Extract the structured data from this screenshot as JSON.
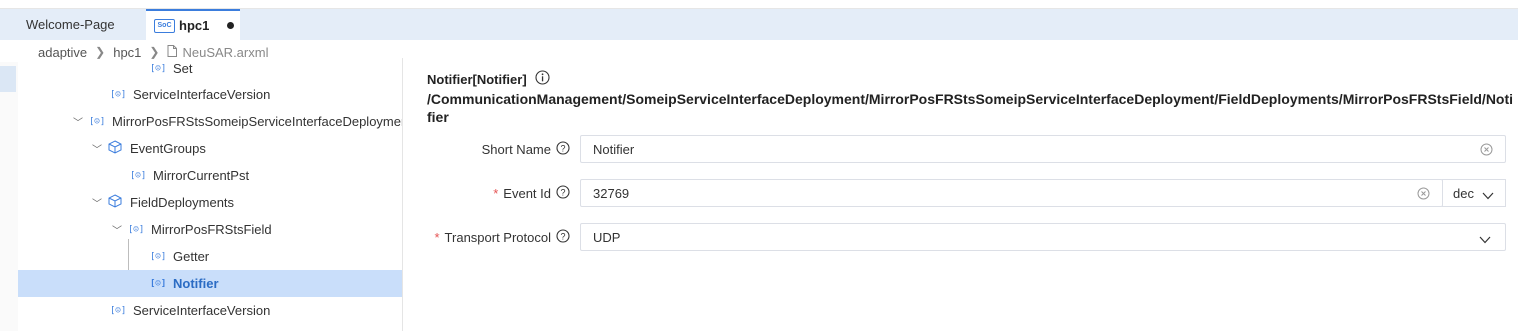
{
  "tabs": [
    {
      "label": "Welcome-Page",
      "icon": ""
    },
    {
      "label": "hpc1",
      "icon": "SoC",
      "dirty": true
    }
  ],
  "breadcrumb": [
    "adaptive",
    "hpc1",
    "NeuSAR.arxml"
  ],
  "tree": [
    {
      "label": "Set",
      "icon": "interface-icon",
      "level": 4
    },
    {
      "label": "ServiceInterfaceVersion",
      "icon": "interface-icon",
      "level": 3
    },
    {
      "label": "MirrorPosFRStsSomeipServiceInterfaceDeployment",
      "icon": "interface-icon",
      "level": 2,
      "expanded": true
    },
    {
      "label": "EventGroups",
      "icon": "cube-icon",
      "level": 3,
      "expanded": true
    },
    {
      "label": "MirrorCurrentPst",
      "icon": "interface-icon",
      "level": 4
    },
    {
      "label": "FieldDeployments",
      "icon": "cube-icon",
      "level": 3,
      "expanded": true
    },
    {
      "label": "MirrorPosFRStsField",
      "icon": "interface-icon",
      "level": 4,
      "expanded": true
    },
    {
      "label": "Getter",
      "icon": "interface-icon",
      "level": 5
    },
    {
      "label": "Notifier",
      "icon": "interface-icon",
      "level": 5,
      "selected": true
    },
    {
      "label": "ServiceInterfaceVersion",
      "icon": "interface-icon",
      "level": 3
    }
  ],
  "detail": {
    "title": "Notifier[Notifier]",
    "path": "/CommunicationManagement/SomeipServiceInterfaceDeployment/MirrorPosFRStsSomeipServiceInterfaceDeployment/FieldDeployments/MirrorPosFRStsField/Notifier",
    "fields": {
      "short_name": {
        "label": "Short Name",
        "value": "Notifier",
        "required": false
      },
      "event_id": {
        "label": "Event Id",
        "value": "32769",
        "required": true,
        "unit": "dec"
      },
      "transport_protocol": {
        "label": "Transport Protocol",
        "value": "UDP",
        "required": true
      }
    }
  },
  "colors": {
    "accent": "#3b7ddd",
    "tab_bar": "#e4edf8",
    "selection": "#c9defa",
    "required": "#e55353"
  }
}
